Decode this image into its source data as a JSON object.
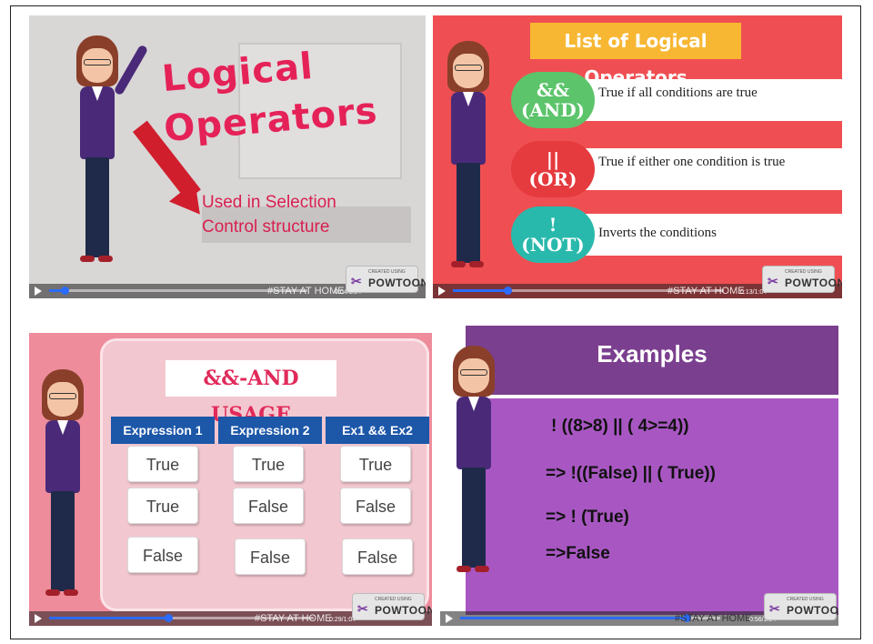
{
  "panel1": {
    "title_line1": "Logical",
    "title_line2": "Operators",
    "subtitle_line1": "Used in Selection",
    "subtitle_line2": "Control structure",
    "stay_text": "#STAY AT HOME",
    "timecode": "0:04/1:04",
    "progress": 0.06
  },
  "panel2": {
    "title": "List of Logical Operators",
    "operators": [
      {
        "symbol": "&&",
        "name": "(AND)",
        "description": "True if all conditions are true",
        "color": "#5cc46b"
      },
      {
        "symbol": "||",
        "name": "(OR)",
        "description": "True if either one condition is true",
        "color": "#e53a3e"
      },
      {
        "symbol": "!",
        "name": "(NOT)",
        "description": "Inverts the conditions",
        "color": "#29b9ac"
      }
    ],
    "stay_text": "#STAY AT HOME",
    "timecode": "0:13/1:04",
    "progress": 0.2
  },
  "panel3": {
    "title": "&&-AND USAGE",
    "headers": [
      "Expression 1",
      "Expression 2",
      "Ex1 && Ex2"
    ],
    "rows": [
      [
        "True",
        "True",
        "True"
      ],
      [
        "True",
        "False",
        "False"
      ],
      [
        "False",
        "False",
        "False"
      ]
    ],
    "stay_text": "#STAY AT HOME",
    "timecode": "0:29/1:04",
    "progress": 0.45
  },
  "panel4": {
    "title": "Examples",
    "lines": [
      "! ((8>8)  ||  ( 4>=4))",
      "=> !((False) || ( True))",
      "=> ! (True)",
      "=>False"
    ],
    "stay_text": "#STAY AT HOME",
    "timecode": "0:56/1:04",
    "progress": 0.87
  },
  "badge": {
    "small": "CREATED USING",
    "name": "POWTOON"
  },
  "colors": {
    "accent_pink": "#e52258",
    "progress_blue": "#2b6bff",
    "header_blue": "#1c57a8",
    "examples_purple": "#7b3f8f"
  }
}
